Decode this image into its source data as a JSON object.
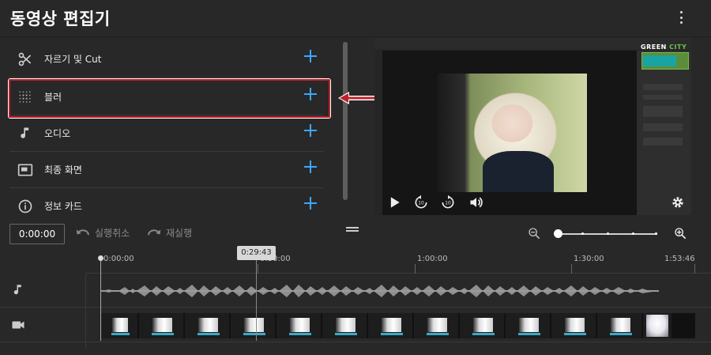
{
  "header": {
    "title": "동영상 편집기"
  },
  "panel": {
    "items": [
      {
        "id": "trim",
        "icon": "scissors-icon",
        "label": "자르기 및 Cut"
      },
      {
        "id": "blur",
        "icon": "blur-icon",
        "label": "블러"
      },
      {
        "id": "audio",
        "icon": "music-note-icon",
        "label": "오디오"
      },
      {
        "id": "end-screen",
        "icon": "end-screen-icon",
        "label": "최종 화면"
      },
      {
        "id": "info-cards",
        "icon": "info-icon",
        "label": "정보 카드"
      }
    ],
    "highlighted_item": "블러"
  },
  "preview": {
    "logo": {
      "prefix": "GREEN",
      "suffix": "CITY"
    }
  },
  "tools": {
    "current_time": "0:00:00",
    "undo_label": "실행취소",
    "redo_label": "재실행",
    "zoom_level": 0.0
  },
  "timeline": {
    "ticks": [
      "0:00:00",
      "0:30:00",
      "1:00:00",
      "1:30:00",
      "1:53:46"
    ],
    "hover_time": "0:29:43"
  },
  "colors": {
    "accent": "#3ea6ff",
    "highlight": "#c0202a",
    "background": "#282828"
  }
}
